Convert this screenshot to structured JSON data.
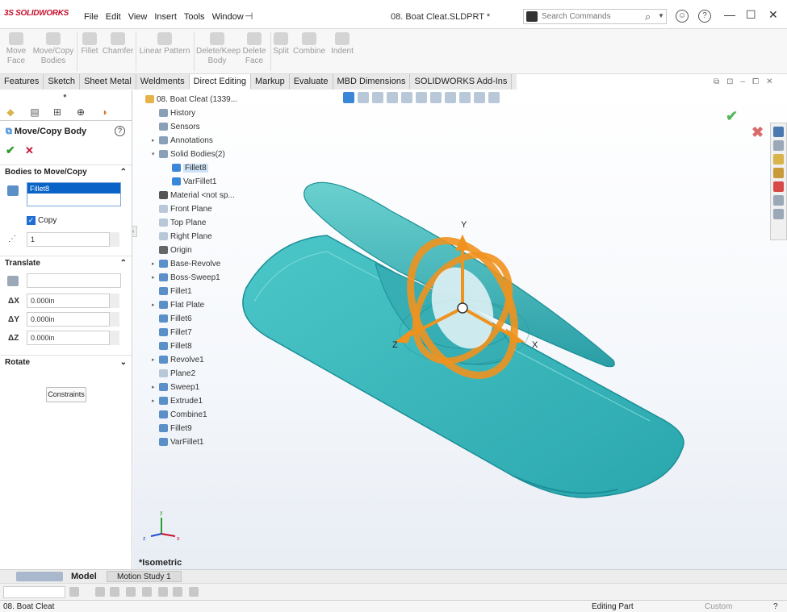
{
  "app": {
    "logo_text": "SOLIDWORKS",
    "document_title": "08. Boat Cleat.SLDPRT *"
  },
  "menu": [
    "File",
    "Edit",
    "View",
    "Insert",
    "Tools",
    "Window"
  ],
  "search": {
    "placeholder": "Search Commands"
  },
  "commands": [
    {
      "label": "Move\nFace"
    },
    {
      "label": "Move/Copy\nBodies"
    },
    {
      "label": "Fillet"
    },
    {
      "label": "Chamfer"
    },
    {
      "label": "Linear Pattern"
    },
    {
      "label": "Delete/Keep\nBody"
    },
    {
      "label": "Delete\nFace"
    },
    {
      "label": "Split"
    },
    {
      "label": "Combine"
    },
    {
      "label": "Indent"
    }
  ],
  "tabs": [
    "Features",
    "Sketch",
    "Sheet Metal",
    "Weldments",
    "Direct Editing",
    "Markup",
    "Evaluate",
    "MBD Dimensions",
    "SOLIDWORKS Add-Ins"
  ],
  "active_tab": "Direct Editing",
  "property_manager": {
    "title": "Move/Copy Body",
    "help": "?",
    "ok": "✔",
    "cancel": "✕",
    "section_bodies": "Bodies to Move/Copy",
    "selected_body": "Fillet8",
    "copy_label": "Copy",
    "copy_checked": true,
    "copy_count": "1",
    "section_translate": "Translate",
    "dx_label": "ΔX",
    "dx": "0.000in",
    "dy_label": "ΔY",
    "dy": "0.000in",
    "dz_label": "ΔZ",
    "dz": "0.000in",
    "section_rotate": "Rotate",
    "constraints_button": "Constraints"
  },
  "tree": {
    "root": "08. Boat Cleat  (1339...",
    "items": [
      "History",
      "Sensors",
      "Annotations",
      "Solid Bodies(2)",
      "Fillet8",
      "VarFillet1",
      "Material <not sp...",
      "Front Plane",
      "Top Plane",
      "Right Plane",
      "Origin",
      "Base-Revolve",
      "Boss-Sweep1",
      "Fillet1",
      "Flat Plate",
      "Fillet6",
      "Fillet7",
      "Fillet8",
      "Revolve1",
      "Plane2",
      "Sweep1",
      "Extrude1",
      "Combine1",
      "Fillet9",
      "VarFillet1"
    ]
  },
  "triad": {
    "x": "X",
    "y": "Y",
    "z": "Z"
  },
  "view_label": "*Isometric",
  "bottom_tabs": {
    "model": "Model",
    "motion": "Motion Study 1"
  },
  "status": {
    "left": "08. Boat Cleat",
    "mode": "Editing Part",
    "units": "Custom"
  },
  "colors": {
    "body": "#3fb6b8",
    "body_dark": "#1a8e96",
    "triad": "#f0921e",
    "accent": "#0a64c8",
    "brand": "#c8102e"
  }
}
